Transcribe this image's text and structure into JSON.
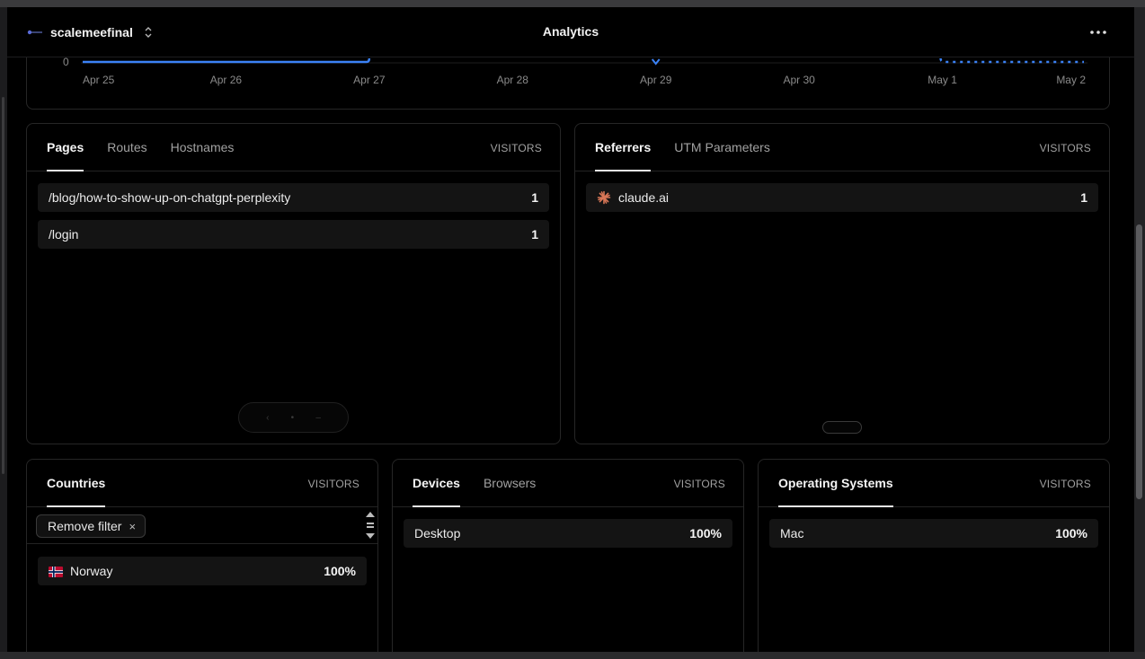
{
  "header": {
    "project_name": "scalemeefinal",
    "title": "Analytics"
  },
  "chart_data": {
    "type": "line",
    "x": [
      "Apr 25",
      "Apr 26",
      "Apr 27",
      "Apr 28",
      "Apr 29",
      "Apr 30",
      "May 1",
      "May 2"
    ],
    "series": [
      {
        "values": [
          0,
          0,
          0,
          null,
          0,
          null,
          0,
          0
        ],
        "style": "solid then dotted from May 1"
      }
    ],
    "y_ticks": [
      "0"
    ],
    "color": "#3b82f6"
  },
  "chart": {
    "y_label_0": "0",
    "x_ticks": [
      "Apr 25",
      "Apr 26",
      "Apr 27",
      "Apr 28",
      "Apr 29",
      "Apr 30",
      "May 1",
      "May 2"
    ]
  },
  "pages_card": {
    "tabs": [
      "Pages",
      "Routes",
      "Hostnames"
    ],
    "column": "VISITORS",
    "rows": [
      {
        "label": "/blog/how-to-show-up-on-chatgpt-perplexity",
        "value": "1"
      },
      {
        "label": "/login",
        "value": "1"
      }
    ]
  },
  "referrers_card": {
    "tabs": [
      "Referrers",
      "UTM Parameters"
    ],
    "column": "VISITORS",
    "rows": [
      {
        "label": "claude.ai",
        "value": "1",
        "icon": "claude-icon"
      }
    ]
  },
  "countries_card": {
    "tabs": [
      "Countries"
    ],
    "column": "VISITORS",
    "filter_chip": "Remove filter",
    "rows": [
      {
        "label": "Norway",
        "value": "100%",
        "icon": "norway-flag-icon"
      }
    ]
  },
  "devices_card": {
    "tabs": [
      "Devices",
      "Browsers"
    ],
    "column": "VISITORS",
    "rows": [
      {
        "label": "Desktop",
        "value": "100%"
      }
    ]
  },
  "os_card": {
    "tabs": [
      "Operating Systems"
    ],
    "column": "VISITORS",
    "rows": [
      {
        "label": "Mac",
        "value": "100%"
      }
    ]
  },
  "colors": {
    "accent": "#3b82f6",
    "background": "#000000",
    "border": "#262626"
  }
}
